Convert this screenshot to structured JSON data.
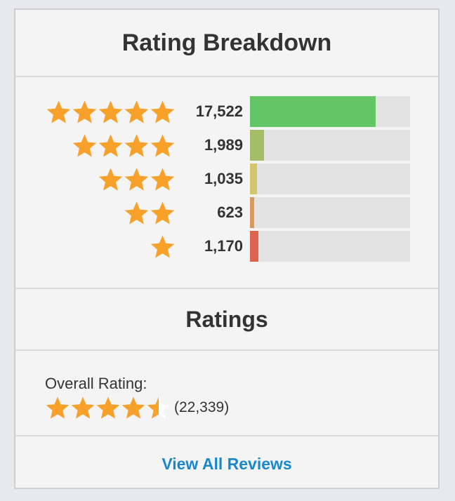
{
  "breakdown": {
    "title": "Rating Breakdown",
    "rows": [
      {
        "stars": 5,
        "count": "17,522",
        "fraction": 0.784,
        "color": "#64c566"
      },
      {
        "stars": 4,
        "count": "1,989",
        "fraction": 0.089,
        "color": "#a3bc66"
      },
      {
        "stars": 3,
        "count": "1,035",
        "fraction": 0.046,
        "color": "#d2c56a"
      },
      {
        "stars": 2,
        "count": "623",
        "fraction": 0.028,
        "color": "#d99a5c"
      },
      {
        "stars": 1,
        "count": "1,170",
        "fraction": 0.052,
        "color": "#de6450"
      }
    ]
  },
  "ratings": {
    "title": "Ratings",
    "overall_label": "Overall Rating:",
    "overall_value": 4.5,
    "overall_count": "(22,339)"
  },
  "footer": {
    "view_all_label": "View All Reviews"
  },
  "colors": {
    "star": "#f7a12a",
    "star_empty": "#ffffff",
    "link": "#1a87c9"
  },
  "icons": {
    "star": "star-icon",
    "half_star": "half-star-icon"
  }
}
